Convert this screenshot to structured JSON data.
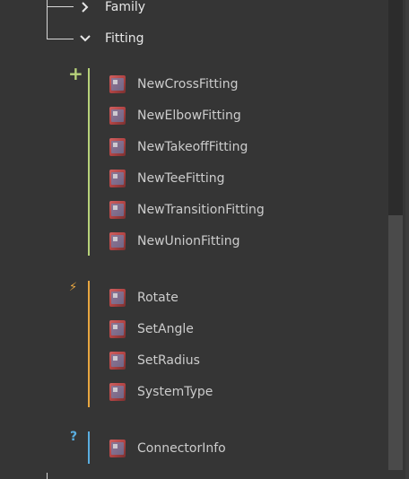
{
  "tree": {
    "categories": [
      {
        "label": "Family",
        "expanded": false
      },
      {
        "label": "Fitting",
        "expanded": true
      }
    ],
    "groups": [
      {
        "kind": "create",
        "icon": "+",
        "color": "#b7d27a",
        "items": [
          "NewCrossFitting",
          "NewElbowFitting",
          "NewTakeoffFitting",
          "NewTeeFitting",
          "NewTransitionFitting",
          "NewUnionFitting"
        ]
      },
      {
        "kind": "action",
        "icon": "⚡",
        "color": "#e8a640",
        "items": [
          "Rotate",
          "SetAngle",
          "SetRadius",
          "SystemType"
        ]
      },
      {
        "kind": "query",
        "icon": "?",
        "color": "#5aaee0",
        "items": [
          "ConnectorInfo"
        ]
      }
    ]
  }
}
